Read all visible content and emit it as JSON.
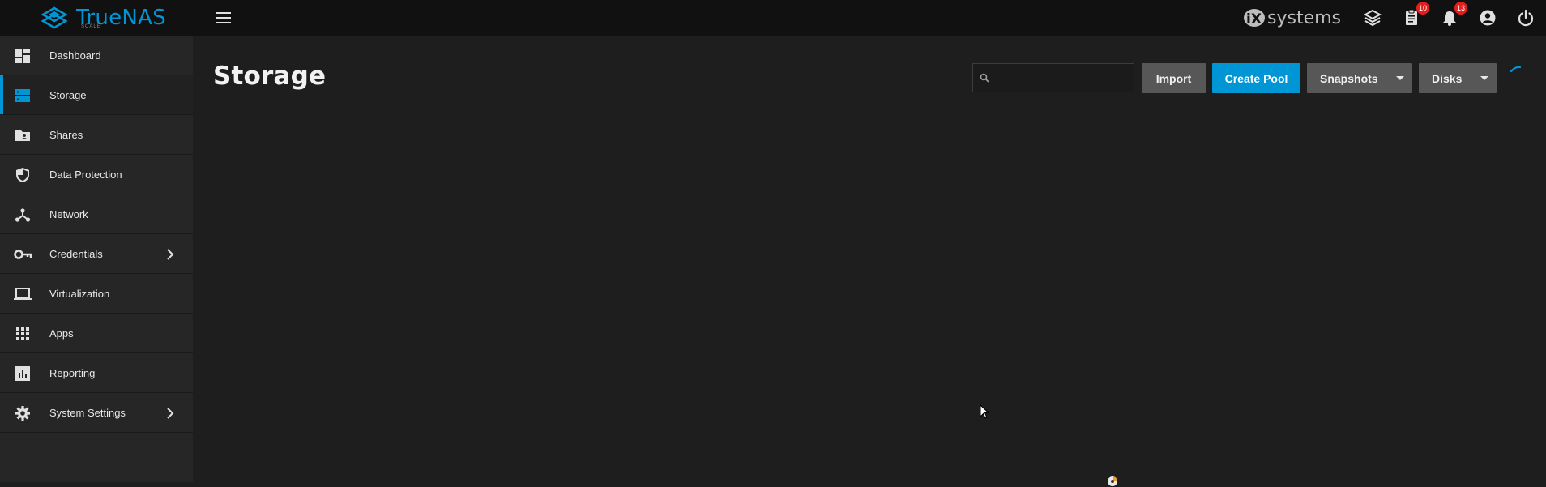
{
  "header": {
    "logo_text": "TrueNAS",
    "logo_sub": "SCALE",
    "vendor_text": "systems",
    "badges": {
      "tasks": "10",
      "alerts": "13"
    }
  },
  "sidebar": {
    "items": [
      {
        "label": "Dashboard",
        "icon": "dashboard-icon",
        "active": false,
        "has_children": false
      },
      {
        "label": "Storage",
        "icon": "storage-icon",
        "active": true,
        "has_children": false
      },
      {
        "label": "Shares",
        "icon": "shares-folder-icon",
        "active": false,
        "has_children": false
      },
      {
        "label": "Data Protection",
        "icon": "shield-icon",
        "active": false,
        "has_children": false
      },
      {
        "label": "Network",
        "icon": "network-icon",
        "active": false,
        "has_children": false
      },
      {
        "label": "Credentials",
        "icon": "key-icon",
        "active": false,
        "has_children": true
      },
      {
        "label": "Virtualization",
        "icon": "laptop-icon",
        "active": false,
        "has_children": false
      },
      {
        "label": "Apps",
        "icon": "apps-grid-icon",
        "active": false,
        "has_children": false
      },
      {
        "label": "Reporting",
        "icon": "chart-icon",
        "active": false,
        "has_children": false
      },
      {
        "label": "System Settings",
        "icon": "gear-icon",
        "active": false,
        "has_children": true
      }
    ]
  },
  "page": {
    "title": "Storage",
    "search_placeholder": "",
    "buttons": {
      "import": "Import",
      "create_pool": "Create Pool",
      "snapshots": "Snapshots",
      "disks": "Disks"
    }
  },
  "colors": {
    "accent": "#0095d5",
    "topbar": "#111111",
    "sidebar": "#262626",
    "content": "#1e1e1e",
    "button": "#575757",
    "badge": "#e41d1d"
  }
}
